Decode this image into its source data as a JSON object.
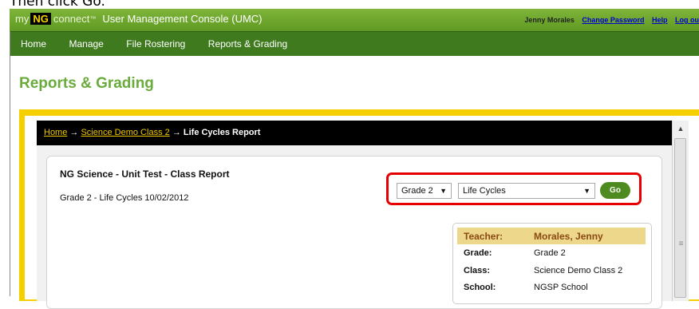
{
  "caption": "Then click Go.",
  "header": {
    "brand_my": "my",
    "brand_ng": "NG",
    "brand_connect": "connect",
    "brand_tm": "™",
    "app_title": "User Management Console (UMC)",
    "user_name": "Jenny Morales",
    "change_password": "Change Password",
    "help": "Help",
    "logout": "Log ou"
  },
  "nav": {
    "items": [
      "Home",
      "Manage",
      "File Rostering",
      "Reports & Grading"
    ]
  },
  "page_title": "Reports & Grading",
  "breadcrumb": {
    "home": "Home",
    "arrow": "→",
    "class": "Science Demo Class 2",
    "current": "Life Cycles Report"
  },
  "report": {
    "title": "NG Science - Unit Test - Class Report",
    "subtitle": "Grade 2 - Life Cycles 10/02/2012"
  },
  "controls": {
    "grade_value": "Grade 2",
    "unit_value": "Life Cycles",
    "go_label": "Go"
  },
  "info": {
    "teacher_label": "Teacher:",
    "teacher_value": "Morales, Jenny",
    "grade_label": "Grade:",
    "grade_value": "Grade 2",
    "class_label": "Class:",
    "class_value": "Science Demo Class 2",
    "school_label": "School:",
    "school_value": "NGSP School"
  },
  "colors": {
    "header_green": "#6aa52c",
    "nav_green": "#3f7a1e",
    "frame_yellow": "#f5cf00",
    "highlight_red": "#e60000"
  }
}
